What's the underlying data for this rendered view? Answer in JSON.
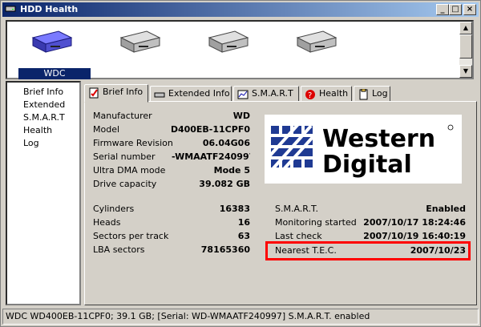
{
  "window": {
    "title": "HDD Health"
  },
  "drives": [
    {
      "label": "WDC",
      "selected": true
    },
    {
      "label": "",
      "selected": false
    },
    {
      "label": "",
      "selected": false
    },
    {
      "label": "",
      "selected": false
    }
  ],
  "sidebar": {
    "items": [
      {
        "label": "Brief Info"
      },
      {
        "label": "Extended"
      },
      {
        "label": "S.M.A.R.T"
      },
      {
        "label": "Health"
      },
      {
        "label": "Log"
      }
    ]
  },
  "tabs": [
    {
      "label": "Brief Info",
      "icon": "brief-info-icon",
      "active": true
    },
    {
      "label": "Extended Info",
      "icon": "extended-info-icon",
      "active": false
    },
    {
      "label": "S.M.A.R.T",
      "icon": "smart-icon",
      "active": false
    },
    {
      "label": "Health",
      "icon": "health-icon",
      "active": false
    },
    {
      "label": "Log",
      "icon": "log-icon",
      "active": false
    }
  ],
  "info": {
    "manufacturer": {
      "label": "Manufacturer",
      "value": "WD"
    },
    "model": {
      "label": "Model",
      "value": "WD400EB-11CPF0"
    },
    "firmware": {
      "label": "Firmware Revision",
      "value": "06.04G06"
    },
    "serial": {
      "label": "Serial number",
      "value": "-WMAATF240997"
    },
    "dma": {
      "label": "Ultra DMA mode",
      "value": "Mode 5"
    },
    "capacity": {
      "label": "Drive capacity",
      "value": "39.082 GB"
    },
    "cylinders": {
      "label": "Cylinders",
      "value": "16383"
    },
    "heads": {
      "label": "Heads",
      "value": "16"
    },
    "sectors": {
      "label": "Sectors per track",
      "value": "63"
    },
    "lba": {
      "label": "LBA sectors",
      "value": "78165360"
    }
  },
  "smart": {
    "smart": {
      "label": "S.M.A.R.T.",
      "value": "Enabled"
    },
    "monitoring": {
      "label": "Monitoring started",
      "value": "2007/10/17 18:24:46"
    },
    "lastcheck": {
      "label": "Last check",
      "value": "2007/10/19 16:40:19"
    },
    "tec": {
      "label": "Nearest T.E.C.",
      "value": "2007/10/23"
    }
  },
  "logo": {
    "line1": "Western",
    "line2": "Digital",
    "brand_color": "#1f3a93"
  },
  "statusbar": {
    "text": "WDC WD400EB-11CPF0;   39.1 GB;   [Serial: WD-WMAATF240997]   S.M.A.R.T. enabled"
  },
  "colors": {
    "selection": "#0a246a",
    "highlight": "#ff0000"
  }
}
